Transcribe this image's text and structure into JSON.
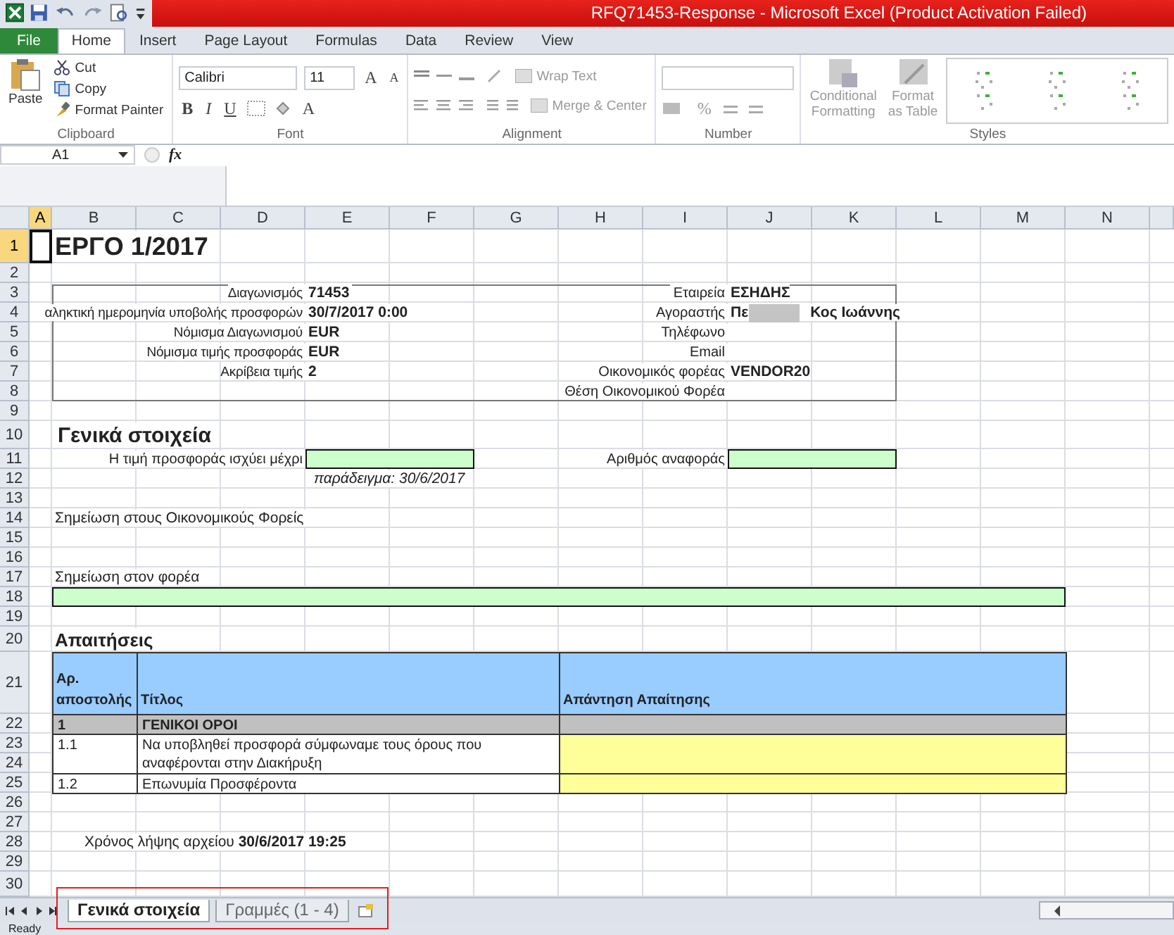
{
  "window": {
    "title": "RFQ71453-Response  -  Microsoft Excel (Product Activation Failed)"
  },
  "ribbon_tabs": [
    {
      "label": "File",
      "kind": "file",
      "selected": false
    },
    {
      "label": "Home",
      "kind": "tab",
      "selected": true
    },
    {
      "label": "Insert",
      "kind": "tab",
      "selected": false
    },
    {
      "label": "Page Layout",
      "kind": "tab",
      "selected": false
    },
    {
      "label": "Formulas",
      "kind": "tab",
      "selected": false
    },
    {
      "label": "Data",
      "kind": "tab",
      "selected": false
    },
    {
      "label": "Review",
      "kind": "tab",
      "selected": false
    },
    {
      "label": "View",
      "kind": "tab",
      "selected": false
    }
  ],
  "ribbon": {
    "clipboard": {
      "label": "Clipboard",
      "paste": "Paste",
      "cut": "Cut",
      "copy": "Copy",
      "format_painter": "Format Painter"
    },
    "font": {
      "label": "Font",
      "name": "Calibri",
      "size": "11",
      "grow": "A",
      "shrink": "A",
      "bold": "B",
      "italic": "I",
      "underline": "U",
      "fc": "A"
    },
    "alignment": {
      "label": "Alignment",
      "wrap": "Wrap Text",
      "merge": "Merge & Center"
    },
    "number": {
      "label": "Number",
      "percent": "%"
    },
    "styles": {
      "label": "Styles",
      "conditional": "Conditional",
      "conditional_2": "Formatting",
      "table": "Format",
      "table_2": "as Table"
    }
  },
  "name_box": "A1",
  "formula_label": "fx",
  "columns": [
    {
      "label": "A",
      "selected": true
    },
    {
      "label": "B",
      "selected": false
    },
    {
      "label": "C",
      "selected": false
    },
    {
      "label": "D",
      "selected": false
    },
    {
      "label": "E",
      "selected": false
    },
    {
      "label": "F",
      "selected": false
    },
    {
      "label": "G",
      "selected": false
    },
    {
      "label": "H",
      "selected": false
    },
    {
      "label": "I",
      "selected": false
    },
    {
      "label": "J",
      "selected": false
    },
    {
      "label": "K",
      "selected": false
    },
    {
      "label": "L",
      "selected": false
    },
    {
      "label": "M",
      "selected": false
    },
    {
      "label": "N",
      "selected": false
    }
  ],
  "rows": [
    {
      "label": "1",
      "selected": true
    },
    {
      "label": "2",
      "selected": false
    },
    {
      "label": "3",
      "selected": false
    },
    {
      "label": "4",
      "selected": false
    },
    {
      "label": "5",
      "selected": false
    },
    {
      "label": "6",
      "selected": false
    },
    {
      "label": "7",
      "selected": false
    },
    {
      "label": "8",
      "selected": false
    },
    {
      "label": "9",
      "selected": false
    },
    {
      "label": "10",
      "selected": false
    },
    {
      "label": "11",
      "selected": false
    },
    {
      "label": "12",
      "selected": false
    },
    {
      "label": "13",
      "selected": false
    },
    {
      "label": "14",
      "selected": false
    },
    {
      "label": "15",
      "selected": false
    },
    {
      "label": "16",
      "selected": false
    },
    {
      "label": "17",
      "selected": false
    },
    {
      "label": "18",
      "selected": false
    },
    {
      "label": "19",
      "selected": false
    },
    {
      "label": "20",
      "selected": false
    },
    {
      "label": "21",
      "selected": false
    },
    {
      "label": "22",
      "selected": false
    },
    {
      "label": "23",
      "selected": false
    },
    {
      "label": "24",
      "selected": false
    },
    {
      "label": "25",
      "selected": false
    },
    {
      "label": "26",
      "selected": false
    },
    {
      "label": "27",
      "selected": false
    },
    {
      "label": "28",
      "selected": false
    },
    {
      "label": "29",
      "selected": false
    },
    {
      "label": "30",
      "selected": false
    }
  ],
  "sheet": {
    "title": "ΕΡΓΟ 1/2017",
    "info_left": [
      {
        "label": "Διαγωνισμός",
        "value": "71453"
      },
      {
        "label": "αληκτική ημερομηνία υποβολής προσφορών",
        "value": "30/7/2017 0:00"
      },
      {
        "label": "Νόμισμα Διαγωνισμού",
        "value": "EUR"
      },
      {
        "label": "Νόμισμα τιμής προσφοράς",
        "value": "EUR"
      },
      {
        "label": "Ακρίβεια τιμής",
        "value": "2"
      }
    ],
    "info_right": [
      {
        "label": "Εταιρεία",
        "value": "ΕΣΗΔΗΣ",
        "redacted": false
      },
      {
        "label": "Αγοραστής",
        "value": "Πε",
        "redacted": true,
        "value_after": "Κος Ιωάννης"
      },
      {
        "label": "Τηλέφωνο",
        "redacted": false
      },
      {
        "label": "Email",
        "redacted": false
      },
      {
        "label": "Οικονομικός φορέας",
        "value": "VENDOR20",
        "redacted": false
      },
      {
        "label": "Θέση Οικονομικού Φορέα",
        "redacted": false
      }
    ],
    "general_heading": "Γενικά στοιχεία",
    "valid_until_label": "Η τιμή προσφοράς ισχύει μέχρι",
    "example": "παράδειγμα:  30/6/2017",
    "reference_label": "Αριθμός αναφοράς",
    "note_vendors": "Σημείωση στους Οικονομικούς Φορείς",
    "note_buyer": "Σημείωση στον φορέα",
    "requirements_heading": "Απαιτήσεις",
    "table": {
      "columns": [
        "Αρ. αποστολής",
        "Τίτλος",
        "Απάντηση Απαίτησης"
      ],
      "rows": [
        {
          "kind": "section",
          "number": "1",
          "title": "ΓΕΝΙΚΟΙ ΟΡΟΙ"
        },
        {
          "kind": "item",
          "number": "1.1",
          "title": "Να υποβληθεί προσφορά σύμφωναμε τους όρους που αναφέρονται στην Διακήρυξη"
        },
        {
          "kind": "item",
          "number": "1.2",
          "title": "Επωνυμία Προσφέροντα"
        }
      ]
    },
    "download_time": "Χρόνος λήψης αρχείου **30/6/2017 19:25**"
  },
  "sheet_tabs": [
    {
      "label": "Γενικά στοιχεία",
      "selected": true
    },
    {
      "label": "Γραμμές (1 - 4)",
      "selected": false
    }
  ],
  "status": "Ready"
}
